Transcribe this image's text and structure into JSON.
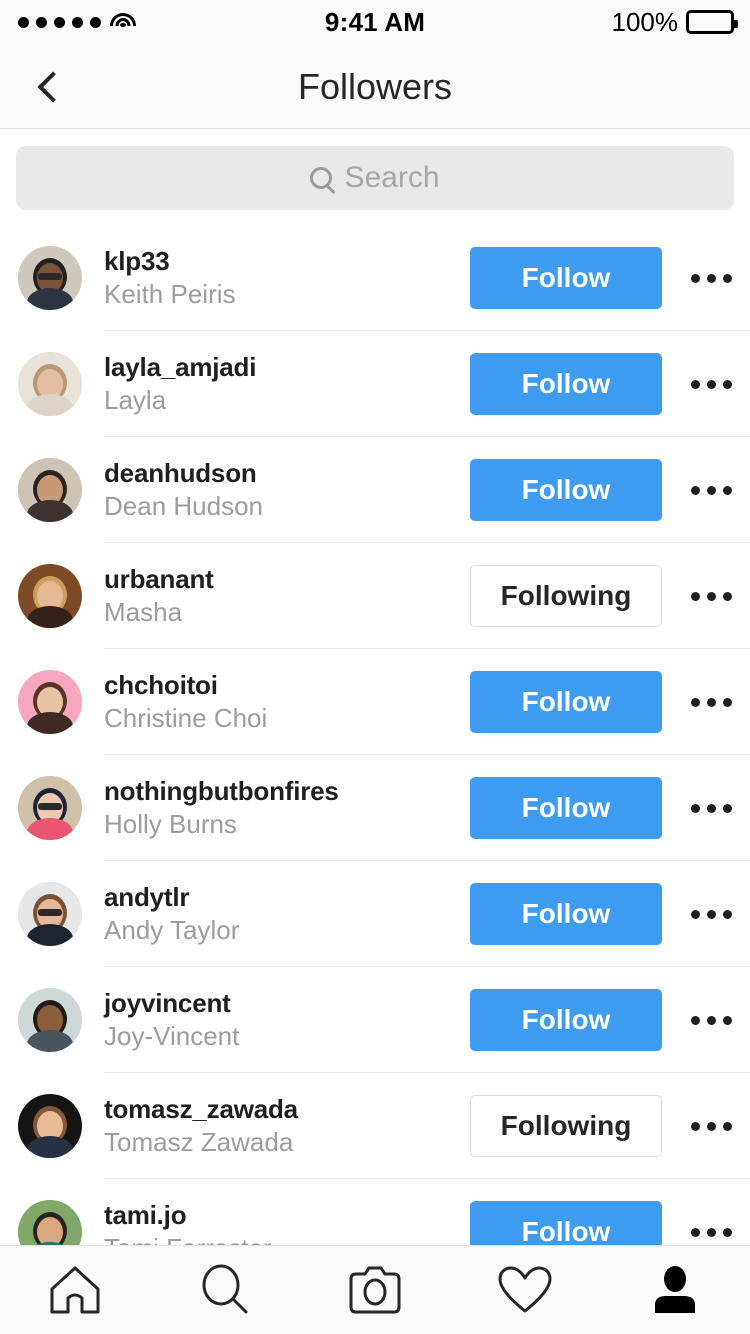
{
  "status_bar": {
    "signal_dots": 5,
    "wifi_icon": "wifi-icon",
    "time": "9:41 AM",
    "battery_percent": "100%",
    "battery_icon": "battery-full-icon"
  },
  "nav": {
    "back_icon": "back-chevron-icon",
    "title": "Followers"
  },
  "search": {
    "icon": "search-icon",
    "placeholder": "Search",
    "value": ""
  },
  "colors": {
    "follow_blue": "#3d9bf0",
    "border_gray": "#dcdcdc",
    "username": "#1f1f1f",
    "fullname": "#9c9c9c",
    "divider": "#e6e6e6",
    "chrome_bg": "#fafafa",
    "search_bg": "#e9e9eb"
  },
  "buttons": {
    "follow_label": "Follow",
    "following_label": "Following",
    "more_icon": "more-options-icon"
  },
  "followers": [
    {
      "username": "klp33",
      "fullname": "Keith Peiris",
      "action": "Follow",
      "following": false,
      "avatar": {
        "name": "avatar-klp33",
        "bg": "#cfc8bd",
        "skin": "#7a5438",
        "hair": "#23211f",
        "shirt": "#2c3440",
        "glasses": true
      }
    },
    {
      "username": "layla_amjadi",
      "fullname": "Layla",
      "action": "Follow",
      "following": false,
      "avatar": {
        "name": "avatar-layla_amjadi",
        "bg": "#e9e2d8",
        "skin": "#e2bfa3",
        "hair": "#b89a72",
        "shirt": "#ddd3c6",
        "glasses": false
      }
    },
    {
      "username": "deanhudson",
      "fullname": "Dean Hudson",
      "action": "Follow",
      "following": false,
      "avatar": {
        "name": "avatar-deanhudson",
        "bg": "#cdc4b6",
        "skin": "#c79a75",
        "hair": "#2b2320",
        "shirt": "#3a3330",
        "glasses": false
      }
    },
    {
      "username": "urbanant",
      "fullname": "Masha",
      "action": "Following",
      "following": true,
      "avatar": {
        "name": "avatar-urbanant",
        "bg": "#7d4a28",
        "skin": "#e6b894",
        "hair": "#caa05e",
        "shirt": "#35211a",
        "glasses": false
      }
    },
    {
      "username": "chchoitoi",
      "fullname": "Christine Choi",
      "action": "Follow",
      "following": false,
      "avatar": {
        "name": "avatar-chchoitoi",
        "bg": "#f7a8c0",
        "skin": "#e8c3a6",
        "hair": "#5a3526",
        "shirt": "#3d2b22",
        "glasses": false
      }
    },
    {
      "username": "nothingbutbonfires",
      "fullname": "Holly Burns",
      "action": "Follow",
      "following": false,
      "avatar": {
        "name": "avatar-nothingbutbonfires",
        "bg": "#cfc0a8",
        "skin": "#eec9ae",
        "hair": "#1e2338",
        "shirt": "#e8566f",
        "glasses": true
      }
    },
    {
      "username": "andytlr",
      "fullname": "Andy Taylor",
      "action": "Follow",
      "following": false,
      "avatar": {
        "name": "avatar-andytlr",
        "bg": "#e7e7e7",
        "skin": "#e5b897",
        "hair": "#7b5234",
        "shirt": "#1d2430",
        "glasses": true
      }
    },
    {
      "username": "joyvincent",
      "fullname": "Joy-Vincent",
      "action": "Follow",
      "following": false,
      "avatar": {
        "name": "avatar-joyvincent",
        "bg": "#cfd8d8",
        "skin": "#8b5e3c",
        "hair": "#211a16",
        "shirt": "#48555c",
        "glasses": false
      }
    },
    {
      "username": "tomasz_zawada",
      "fullname": "Tomasz Zawada",
      "action": "Following",
      "following": true,
      "avatar": {
        "name": "avatar-tomasz_zawada",
        "bg": "#161412",
        "skin": "#e8bb96",
        "hair": "#7d5a3a",
        "shirt": "#263243",
        "glasses": false
      }
    },
    {
      "username": "tami.jo",
      "fullname": "Tami Forrester",
      "action": "Follow",
      "following": false,
      "avatar": {
        "name": "avatar-tami-jo",
        "bg": "#7fa86a",
        "skin": "#d9a87e",
        "hair": "#2b2320",
        "shirt": "#2f6d7a",
        "glasses": false
      }
    }
  ],
  "tab_bar": {
    "tabs": [
      {
        "name": "home-tab",
        "icon": "home-icon",
        "active": false
      },
      {
        "name": "search-tab",
        "icon": "search-icon",
        "active": false
      },
      {
        "name": "camera-tab",
        "icon": "camera-icon",
        "active": false
      },
      {
        "name": "activity-tab",
        "icon": "heart-icon",
        "active": false
      },
      {
        "name": "profile-tab",
        "icon": "person-icon",
        "active": true
      }
    ]
  }
}
